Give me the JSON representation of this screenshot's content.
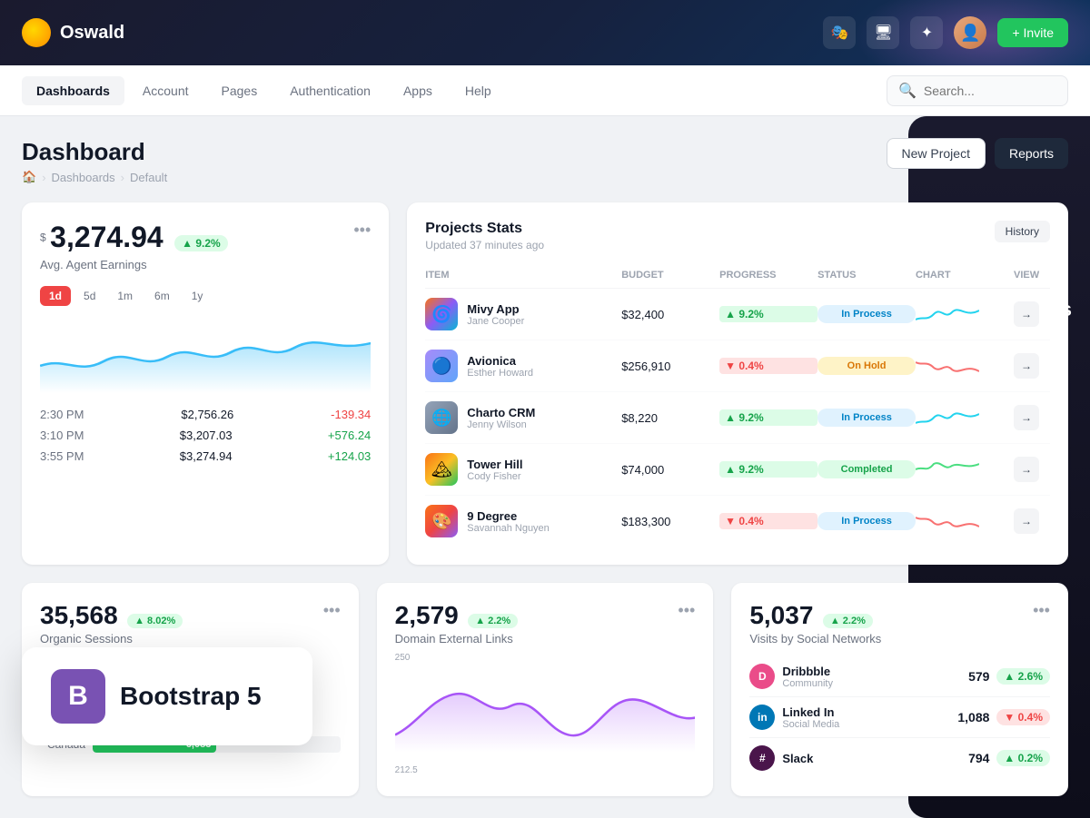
{
  "topnav": {
    "logo_text": "Oswald",
    "invite_label": "+ Invite"
  },
  "secondarynav": {
    "items": [
      {
        "label": "Dashboards",
        "active": true
      },
      {
        "label": "Account",
        "active": false
      },
      {
        "label": "Pages",
        "active": false
      },
      {
        "label": "Authentication",
        "active": false
      },
      {
        "label": "Apps",
        "active": false
      },
      {
        "label": "Help",
        "active": false
      }
    ],
    "search_placeholder": "Search..."
  },
  "page": {
    "title": "Dashboard",
    "breadcrumb": [
      "🏠",
      "Dashboards",
      "Default"
    ],
    "new_project_label": "New Project",
    "reports_label": "Reports"
  },
  "earnings_card": {
    "currency": "$",
    "amount": "3,274.94",
    "badge": "▲ 9.2%",
    "label": "Avg. Agent Earnings",
    "time_filters": [
      "1d",
      "5d",
      "1m",
      "6m",
      "1y"
    ],
    "active_filter": "1d",
    "rows": [
      {
        "time": "2:30 PM",
        "value": "$2,756.26",
        "change": "-139.34",
        "positive": false
      },
      {
        "time": "3:10 PM",
        "value": "$3,207.03",
        "change": "+576.24",
        "positive": true
      },
      {
        "time": "3:55 PM",
        "value": "$3,274.94",
        "change": "+124.03",
        "positive": true
      }
    ]
  },
  "projects_stats": {
    "title": "Projects Stats",
    "subtitle": "Updated 37 minutes ago",
    "history_label": "History",
    "columns": [
      "ITEM",
      "BUDGET",
      "PROGRESS",
      "STATUS",
      "CHART",
      "VIEW"
    ],
    "rows": [
      {
        "name": "Mivy App",
        "sub": "Jane Cooper",
        "budget": "$32,400",
        "progress": "▲ 9.2%",
        "progress_up": true,
        "status": "In Process",
        "status_class": "in-process",
        "color": "#22d3ee"
      },
      {
        "name": "Avionica",
        "sub": "Esther Howard",
        "budget": "$256,910",
        "progress": "▼ 0.4%",
        "progress_up": false,
        "status": "On Hold",
        "status_class": "on-hold",
        "color": "#f87171"
      },
      {
        "name": "Charto CRM",
        "sub": "Jenny Wilson",
        "budget": "$8,220",
        "progress": "▲ 9.2%",
        "progress_up": true,
        "status": "In Process",
        "status_class": "in-process",
        "color": "#22d3ee"
      },
      {
        "name": "Tower Hill",
        "sub": "Cody Fisher",
        "budget": "$74,000",
        "progress": "▲ 9.2%",
        "progress_up": true,
        "status": "Completed",
        "status_class": "completed",
        "color": "#4ade80"
      },
      {
        "name": "9 Degree",
        "sub": "Savannah Nguyen",
        "budget": "$183,300",
        "progress": "▼ 0.4%",
        "progress_up": false,
        "status": "In Process",
        "status_class": "in-process",
        "color": "#f87171"
      }
    ]
  },
  "organic_sessions": {
    "amount": "35,568",
    "badge": "▲ 8.02%",
    "label": "Organic Sessions",
    "bars": [
      {
        "label": "Canada",
        "value": 6083,
        "max": 12000
      }
    ]
  },
  "domain_links": {
    "amount": "2,579",
    "badge": "▲ 2.2%",
    "label": "Domain External Links"
  },
  "social_networks": {
    "amount": "5,037",
    "badge": "▲ 2.2%",
    "label": "Visits by Social Networks",
    "rows": [
      {
        "name": "Dribbble",
        "type": "Community",
        "count": "579",
        "change": "▲ 2.6%",
        "up": true,
        "color": "#ea4c89"
      },
      {
        "name": "Linked In",
        "type": "Social Media",
        "count": "1,088",
        "change": "▼ 0.4%",
        "up": false,
        "color": "#0077b5"
      },
      {
        "name": "Slack",
        "type": "",
        "count": "794",
        "change": "▲ 0.2%",
        "up": true,
        "color": "#4a154b"
      }
    ]
  },
  "bootstrap_card": {
    "icon_label": "B",
    "text": "Bootstrap 5"
  },
  "reports_overlay": "Reports"
}
